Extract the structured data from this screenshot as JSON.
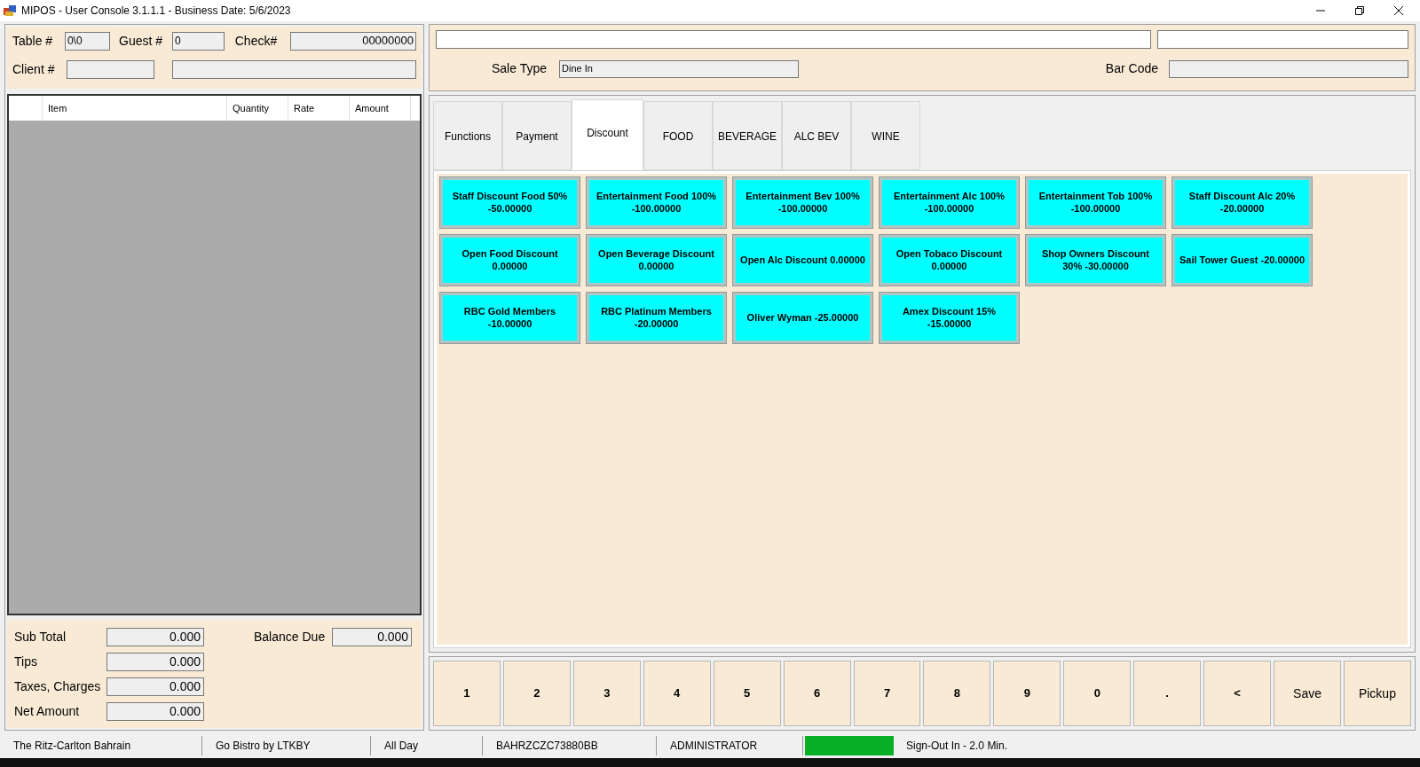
{
  "window": {
    "title": "MIPOS - User Console 3.1.1.1 - Business Date: 5/6/2023"
  },
  "header": {
    "fields": [
      {
        "label": "Table #",
        "value": "0\\0"
      },
      {
        "label": "Guest #",
        "value": "0"
      },
      {
        "label": "Check#",
        "value": "00000000"
      },
      {
        "label": "Client #"
      }
    ]
  },
  "order_table": {
    "columns": [
      "",
      "Item",
      "Quantity",
      "Rate",
      "Amount"
    ]
  },
  "totals": [
    {
      "label": "Sub Total",
      "value": "0.000"
    },
    {
      "label": "Tips",
      "value": "0.000"
    },
    {
      "label": "Taxes, Charges",
      "value": "0.000"
    },
    {
      "label": "Net Amount",
      "value": "0.000"
    }
  ],
  "balance_due": {
    "label": "Balance Due",
    "value": "0.000"
  },
  "sale_type": {
    "label": "Sale Type",
    "value": "Dine In"
  },
  "bar_code": {
    "label": "Bar Code"
  },
  "tabs": [
    {
      "label": "Functions",
      "selected": false
    },
    {
      "label": "Payment",
      "selected": false
    },
    {
      "label": "Discount",
      "selected": true
    },
    {
      "label": "FOOD",
      "selected": false
    },
    {
      "label": "BEVERAGE",
      "selected": false
    },
    {
      "label": "ALC BEV",
      "selected": false
    },
    {
      "label": "WINE",
      "selected": false
    }
  ],
  "discount_buttons": [
    [
      "Staff Discount Food 50%",
      "-50.00000"
    ],
    [
      "Entertainment Food 100%",
      "-100.00000"
    ],
    [
      "Entertainment Bev 100%",
      "-100.00000"
    ],
    [
      "Entertainment Alc 100%",
      "-100.00000"
    ],
    [
      "Entertainment Tob 100%",
      "-100.00000"
    ],
    [
      "Staff Discount Alc 20%",
      "-20.00000"
    ],
    [
      "Open Food Discount",
      "0.00000"
    ],
    [
      "Open Beverage Discount",
      "0.00000"
    ],
    [
      "Open Alc Discount 0.00000"
    ],
    [
      "Open Tobaco Discount",
      "0.00000"
    ],
    [
      "Shop Owners Discount",
      "30% -30.00000"
    ],
    [
      "Sail Tower Guest -20.00000"
    ],
    [
      "RBC Gold Members",
      "-10.00000"
    ],
    [
      "RBC Platinum Members",
      "-20.00000"
    ],
    [
      "Oliver Wyman -25.00000"
    ],
    [
      "Amex Discount 15%",
      "-15.00000"
    ]
  ],
  "keypad": [
    {
      "label": "1",
      "kind": "digit"
    },
    {
      "label": "2",
      "kind": "digit"
    },
    {
      "label": "3",
      "kind": "digit"
    },
    {
      "label": "4",
      "kind": "digit"
    },
    {
      "label": "5",
      "kind": "digit"
    },
    {
      "label": "6",
      "kind": "digit"
    },
    {
      "label": "7",
      "kind": "digit"
    },
    {
      "label": "8",
      "kind": "digit"
    },
    {
      "label": "9",
      "kind": "digit"
    },
    {
      "label": "0",
      "kind": "digit"
    },
    {
      "label": ".",
      "kind": "digit"
    },
    {
      "label": "<",
      "kind": "digit"
    },
    {
      "label": "Save",
      "kind": "command"
    },
    {
      "label": "Pickup",
      "kind": "command"
    }
  ],
  "status_bar": [
    "The Ritz-Carlton Bahrain",
    "Go Bistro by LTKBY",
    "All Day",
    "BAHRZCZC73880BB",
    "ADMINISTRATOR",
    "Sign-Out In - 2.0 Min."
  ]
}
